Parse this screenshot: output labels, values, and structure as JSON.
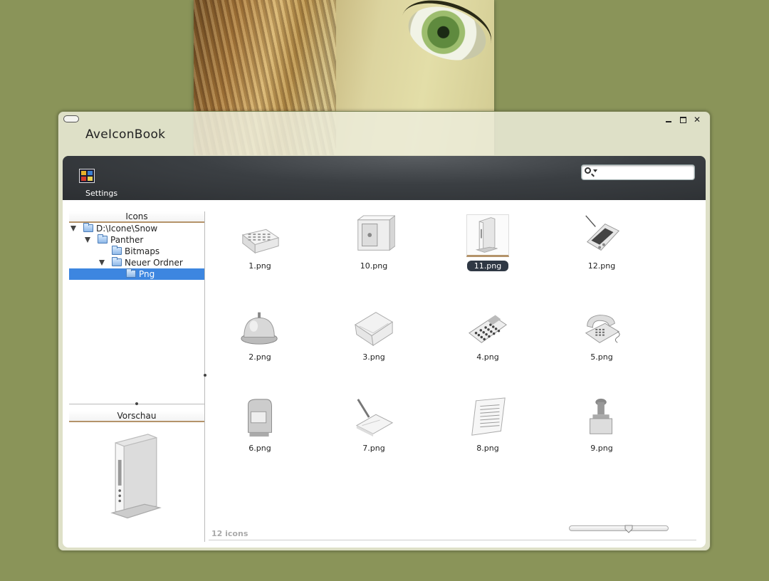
{
  "window": {
    "title": "AveIconBook"
  },
  "toolbar": {
    "settings_label": "Settings",
    "search": {
      "value": "",
      "placeholder": ""
    }
  },
  "sidebar": {
    "icons_header": "Icons",
    "tree": [
      {
        "label": "D:\\Icone\\Snow",
        "depth": 0,
        "expanded": true,
        "selected": false
      },
      {
        "label": "Panther",
        "depth": 1,
        "expanded": true,
        "selected": false
      },
      {
        "label": "Bitmaps",
        "depth": 2,
        "expanded": false,
        "selected": false
      },
      {
        "label": "Neuer Ordner",
        "depth": 2,
        "expanded": true,
        "selected": false
      },
      {
        "label": "Png",
        "depth": 3,
        "expanded": false,
        "selected": true
      }
    ],
    "preview_header": "Vorschau",
    "preview_icon": "desktop-tower-icon"
  },
  "grid": {
    "items": [
      {
        "name": "1.png",
        "icon": "calendar-icon"
      },
      {
        "name": "10.png",
        "icon": "safe-icon"
      },
      {
        "name": "11.png",
        "icon": "desktop-tower-icon",
        "selected": true
      },
      {
        "name": "12.png",
        "icon": "pda-icon"
      },
      {
        "name": "2.png",
        "icon": "service-bell-icon"
      },
      {
        "name": "3.png",
        "icon": "envelope-icon"
      },
      {
        "name": "4.png",
        "icon": "calculator-icon"
      },
      {
        "name": "5.png",
        "icon": "telephone-icon"
      },
      {
        "name": "6.png",
        "icon": "mailbox-icon"
      },
      {
        "name": "7.png",
        "icon": "notepad-pen-icon"
      },
      {
        "name": "8.png",
        "icon": "document-icon"
      },
      {
        "name": "9.png",
        "icon": "stamp-icon"
      }
    ],
    "count_label": "12 icons",
    "zoom": 0.6
  },
  "colors": {
    "background": "#8a9459",
    "selection": "#3d86e0",
    "accent": "#b4936a"
  }
}
